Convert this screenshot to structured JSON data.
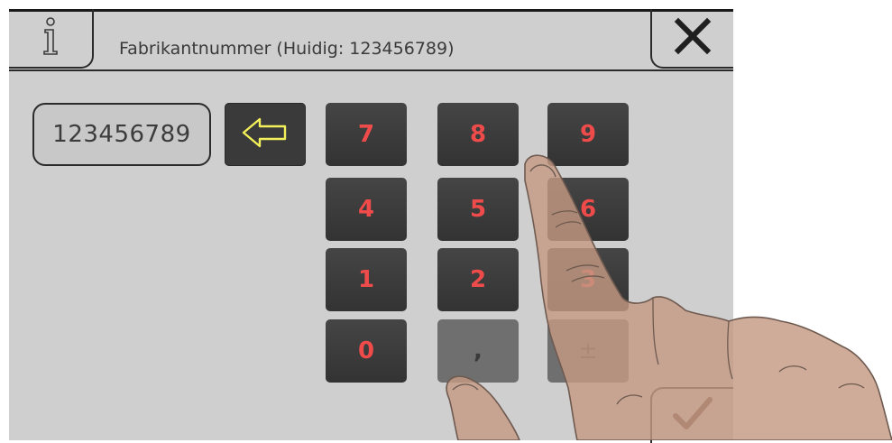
{
  "header": {
    "title": "Fabrikantnummer (Huidig: 123456789)",
    "info_icon": "info-icon",
    "close_icon": "close-icon"
  },
  "input": {
    "value": "123456789",
    "backspace_icon": "arrow-left-outline-icon"
  },
  "keypad": {
    "row1": [
      "7",
      "8",
      "9"
    ],
    "row2": [
      "4",
      "5",
      "6"
    ],
    "row3": [
      "1",
      "2",
      "3"
    ],
    "row4": [
      "0",
      ",",
      "±"
    ]
  },
  "footer": {
    "confirm_icon": "checkmark-icon"
  },
  "colors": {
    "background": "#cfcfcf",
    "key": "#3a3a3a",
    "key_text": "#ef4b4b",
    "backspace_arrow": "#f2ef5a"
  }
}
